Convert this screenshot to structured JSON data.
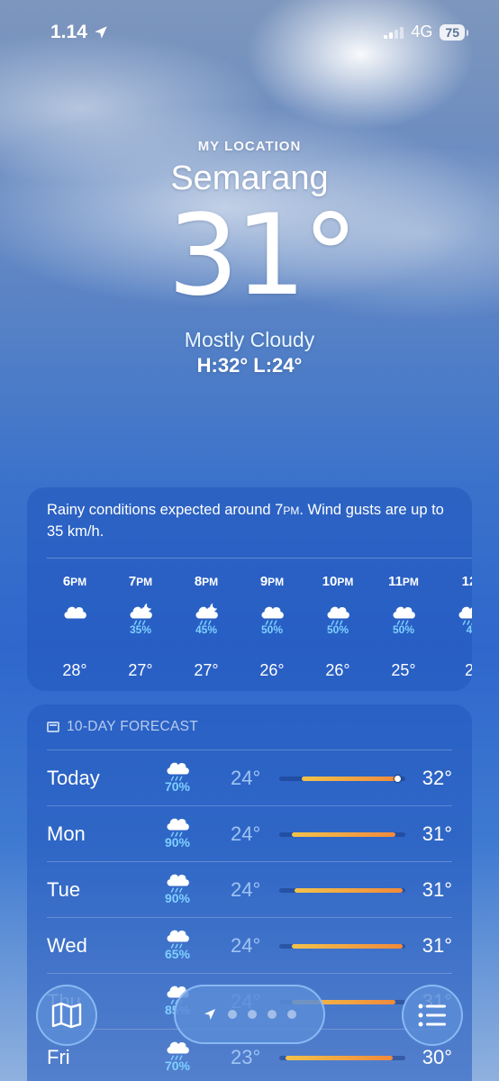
{
  "status": {
    "time": "1.14",
    "network": "4G",
    "battery": "75"
  },
  "header": {
    "location_label": "MY LOCATION",
    "city": "Semarang",
    "temperature": "31°",
    "condition": "Mostly Cloudy",
    "high_low": "H:32°  L:24°"
  },
  "hourly": {
    "summary_a": "Rainy conditions expected around 7",
    "summary_pm": "PM",
    "summary_b": ". Wind gusts are up to 35 km/h.",
    "hours": [
      {
        "time": "6",
        "suffix": "PM",
        "icon": "cloud-icon",
        "precip": "",
        "temp": "28°"
      },
      {
        "time": "7",
        "suffix": "PM",
        "icon": "cloud-moon-rain-icon",
        "precip": "35%",
        "temp": "27°"
      },
      {
        "time": "8",
        "suffix": "PM",
        "icon": "cloud-moon-rain-icon",
        "precip": "45%",
        "temp": "27°"
      },
      {
        "time": "9",
        "suffix": "PM",
        "icon": "cloud-rain-icon",
        "precip": "50%",
        "temp": "26°"
      },
      {
        "time": "10",
        "suffix": "PM",
        "icon": "cloud-rain-icon",
        "precip": "50%",
        "temp": "26°"
      },
      {
        "time": "11",
        "suffix": "PM",
        "icon": "cloud-rain-icon",
        "precip": "50%",
        "temp": "25°"
      },
      {
        "time": "12",
        "suffix": "",
        "icon": "cloud-rain-icon",
        "precip": "4",
        "temp": "2"
      }
    ]
  },
  "forecast": {
    "title": "10-DAY FORECAST",
    "days": [
      {
        "day": "Today",
        "icon": "cloud-rain-icon",
        "precip": "70%",
        "low": "24°",
        "high": "32°",
        "range": [
          0.18,
          0.95
        ],
        "current": 0.94
      },
      {
        "day": "Mon",
        "icon": "cloud-rain-icon",
        "precip": "90%",
        "low": "24°",
        "high": "31°",
        "range": [
          0.1,
          0.92
        ]
      },
      {
        "day": "Tue",
        "icon": "cloud-rain-icon",
        "precip": "90%",
        "low": "24°",
        "high": "31°",
        "range": [
          0.12,
          0.98
        ]
      },
      {
        "day": "Wed",
        "icon": "cloud-rain-icon",
        "precip": "65%",
        "low": "24°",
        "high": "31°",
        "range": [
          0.1,
          0.98
        ]
      },
      {
        "day": "Thu",
        "icon": "cloud-rain-icon",
        "precip": "85%",
        "low": "24°",
        "high": "31°",
        "range": [
          0.1,
          0.92
        ]
      },
      {
        "day": "Fri",
        "icon": "cloud-rain-icon",
        "precip": "70%",
        "low": "23°",
        "high": "30°",
        "range": [
          0.05,
          0.9
        ]
      }
    ]
  },
  "nav": {
    "map": "map-icon",
    "location": "location-arrow-icon",
    "list": "list-icon",
    "pages": 4
  }
}
